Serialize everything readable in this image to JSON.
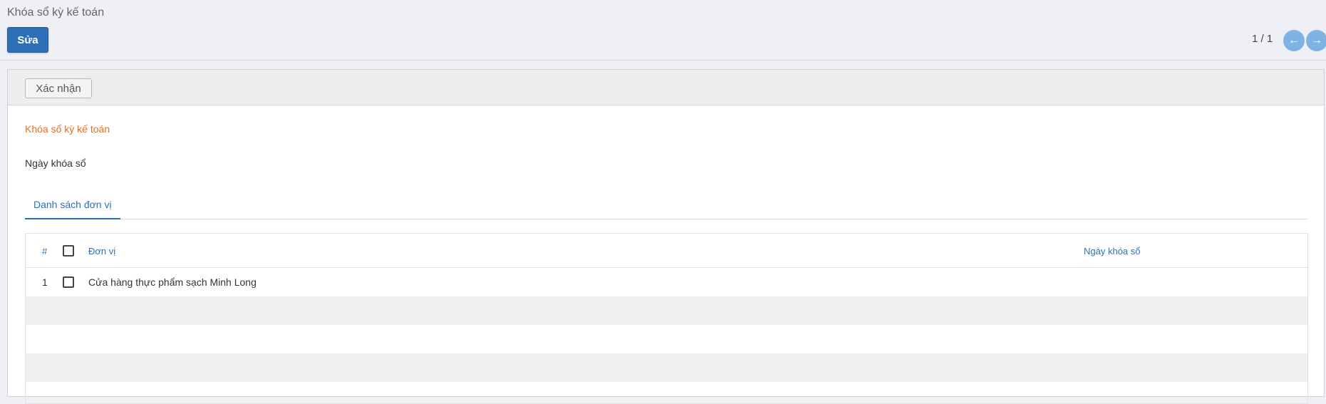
{
  "header": {
    "breadcrumb": "Khóa sổ kỳ kế toán",
    "edit_label": "Sửa",
    "pager": "1 / 1",
    "prev_icon": "←",
    "next_icon": "→"
  },
  "statusbar": {
    "confirm_label": "Xác nhận"
  },
  "form": {
    "title": "Khóa sổ kỳ kế toán",
    "close_date_label": "Ngày khóa sổ",
    "tab_units": "Danh sách đơn vị"
  },
  "table": {
    "columns": [
      "#",
      "Đơn vị",
      "Ngày khóa sổ"
    ],
    "rows": [
      {
        "index": "1",
        "unit": "Cửa hàng thực phẩm sạch Minh Long",
        "close_date": ""
      }
    ]
  }
}
